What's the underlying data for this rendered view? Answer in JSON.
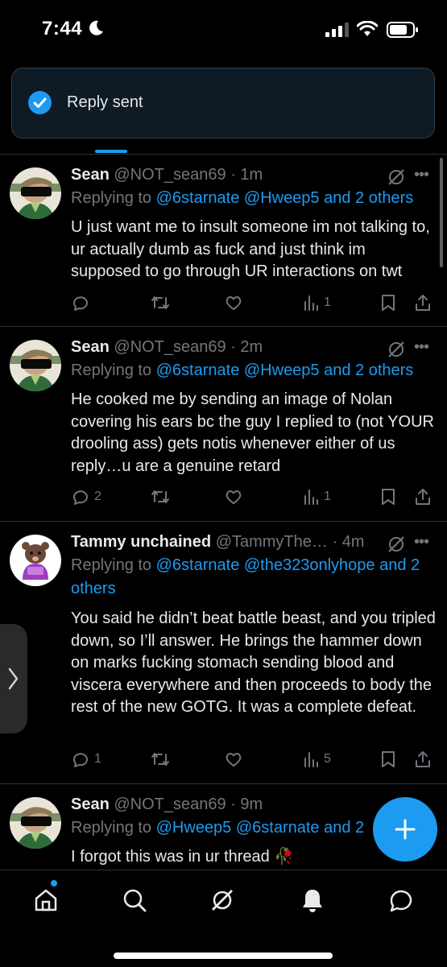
{
  "status_bar": {
    "time": "7:44"
  },
  "toast": {
    "message": "Reply sent"
  },
  "tweets": [
    {
      "name": "Sean",
      "handle": "@NOT_sean69",
      "time": "1m",
      "replying_prefix": "Replying to",
      "replying_to": "@6starnate @Hweep5 and 2 others",
      "text": "U just want me to insult someone im not talking to, ur actually dumb as fuck and just think im supposed to go through UR interactions on twt",
      "replies": "",
      "views": "1"
    },
    {
      "name": "Sean",
      "handle": "@NOT_sean69",
      "time": "2m",
      "replying_prefix": "Replying to",
      "replying_to": "@6starnate @Hweep5 and 2 others",
      "text": "He cooked me by sending an image of Nolan covering his ears bc the guy I replied to (not YOUR drooling ass) gets notis whenever either of us reply…u are a genuine retard",
      "replies": "2",
      "views": "1"
    },
    {
      "name": "Tammy unchained",
      "handle": "@TammyThe…",
      "time": "4m",
      "replying_prefix": "Replying to",
      "replying_to": "@6starnate @the323onlyhope and 2 others",
      "text": "You said he didn’t beat battle beast, and you tripled down, so I’ll answer. He brings the hammer down on marks fucking stomach sending blood and viscera everywhere and then proceeds to body the rest of the new GOTG. It was a complete defeat.",
      "replies": "1",
      "views": "5"
    },
    {
      "name": "Sean",
      "handle": "@NOT_sean69",
      "time": "9m",
      "replying_prefix": "Replying to",
      "replying_to": "@Hweep5 @6starnate and 2",
      "text": "I forgot this was in ur thread 🥀",
      "replies": "",
      "views": ""
    }
  ],
  "separator": " · ",
  "more_label": "•••",
  "icons": [
    "moon-icon",
    "signal-icon",
    "wifi-icon",
    "battery-icon",
    "check-icon",
    "grok-icon",
    "reply-icon",
    "retweet-icon",
    "like-icon",
    "views-icon",
    "bookmark-icon",
    "share-icon",
    "chevron-right-icon",
    "plus-icon",
    "home-icon",
    "search-icon",
    "notifications-icon",
    "messages-icon"
  ],
  "colors": {
    "accent": "#1d9bf0",
    "background": "#000000",
    "text": "#e7e9ea",
    "muted": "#71767b"
  }
}
